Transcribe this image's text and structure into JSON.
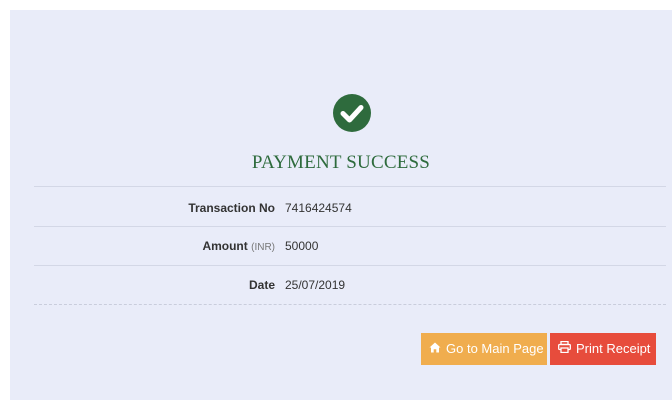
{
  "status": {
    "title": "PAYMENT SUCCESS",
    "icon": "check-circle-icon",
    "color": "#2e6b3d"
  },
  "details": {
    "transaction": {
      "label": "Transaction No",
      "value": "7416424574"
    },
    "amount": {
      "label": "Amount",
      "unit": "(INR)",
      "value": "50000"
    },
    "date": {
      "label": "Date",
      "value": "25/07/2019"
    }
  },
  "actions": {
    "main_page": {
      "label": "Go to Main Page",
      "icon": "home-icon",
      "color": "#f0ad4e"
    },
    "print": {
      "label": "Print Receipt",
      "icon": "print-icon",
      "color": "#e74c3c"
    }
  }
}
